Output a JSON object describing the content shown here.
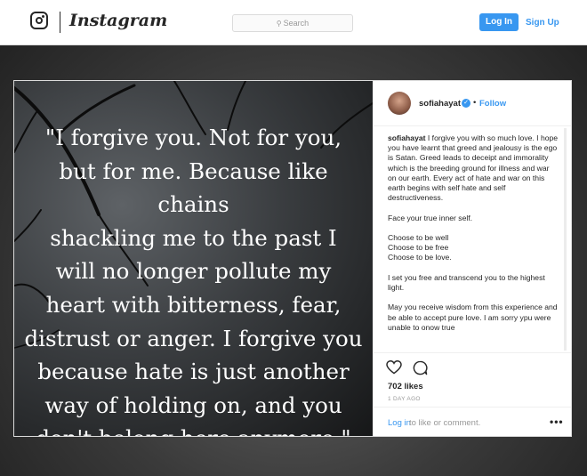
{
  "nav": {
    "brand": "Instagram",
    "search_placeholder": "Search",
    "login_label": "Log In",
    "signup_label": "Sign Up"
  },
  "photo": {
    "quote_lines": [
      "\"I forgive you. Not for you,",
      "but for me. Because like chains",
      "shackling me to the past I",
      "will no longer pollute my",
      "heart with bitterness, fear,",
      "distrust or anger. I forgive you",
      "because hate is just another",
      "way of holding on, and you",
      "don't belong here anymore.\""
    ]
  },
  "post": {
    "username": "sofiahayat",
    "bullet": "•",
    "follow_label": "Follow",
    "caption_user": "sofiahayat",
    "caption_first": "I forgive you with so much love. I hope you have learnt that greed and jealousy is the ego is Satan. Greed leads to deceipt and immorality which is the breeding ground for illness and war on our earth. Every act of hate and war on this earth begins with self hate and self destructiveness.",
    "caption_p2": "Face your true inner self.",
    "caption_p3a": "Choose to be well",
    "caption_p3b": "Choose to be free",
    "caption_p3c": "Choose to be love.",
    "caption_p4": "I set you free and transcend you to the highest light.",
    "caption_p5": "May you receive wisdom from this experience and be able to accept pure love. I am sorry ypu were unable to onow true",
    "likes": "702 likes",
    "timestamp": "1 DAY AGO",
    "comment_login": "Log in",
    "comment_rest": "to like or comment.",
    "more": "•••"
  },
  "icons": {
    "instagram": "instagram-glyph-icon",
    "search": "search-icon",
    "verified": "verified-badge-icon",
    "like": "heart-icon",
    "comment": "comment-bubble-icon",
    "more": "more-options-icon"
  },
  "colors": {
    "accent": "#3897f0",
    "text": "#262626",
    "muted": "#999999",
    "border": "#dbdbdb"
  }
}
